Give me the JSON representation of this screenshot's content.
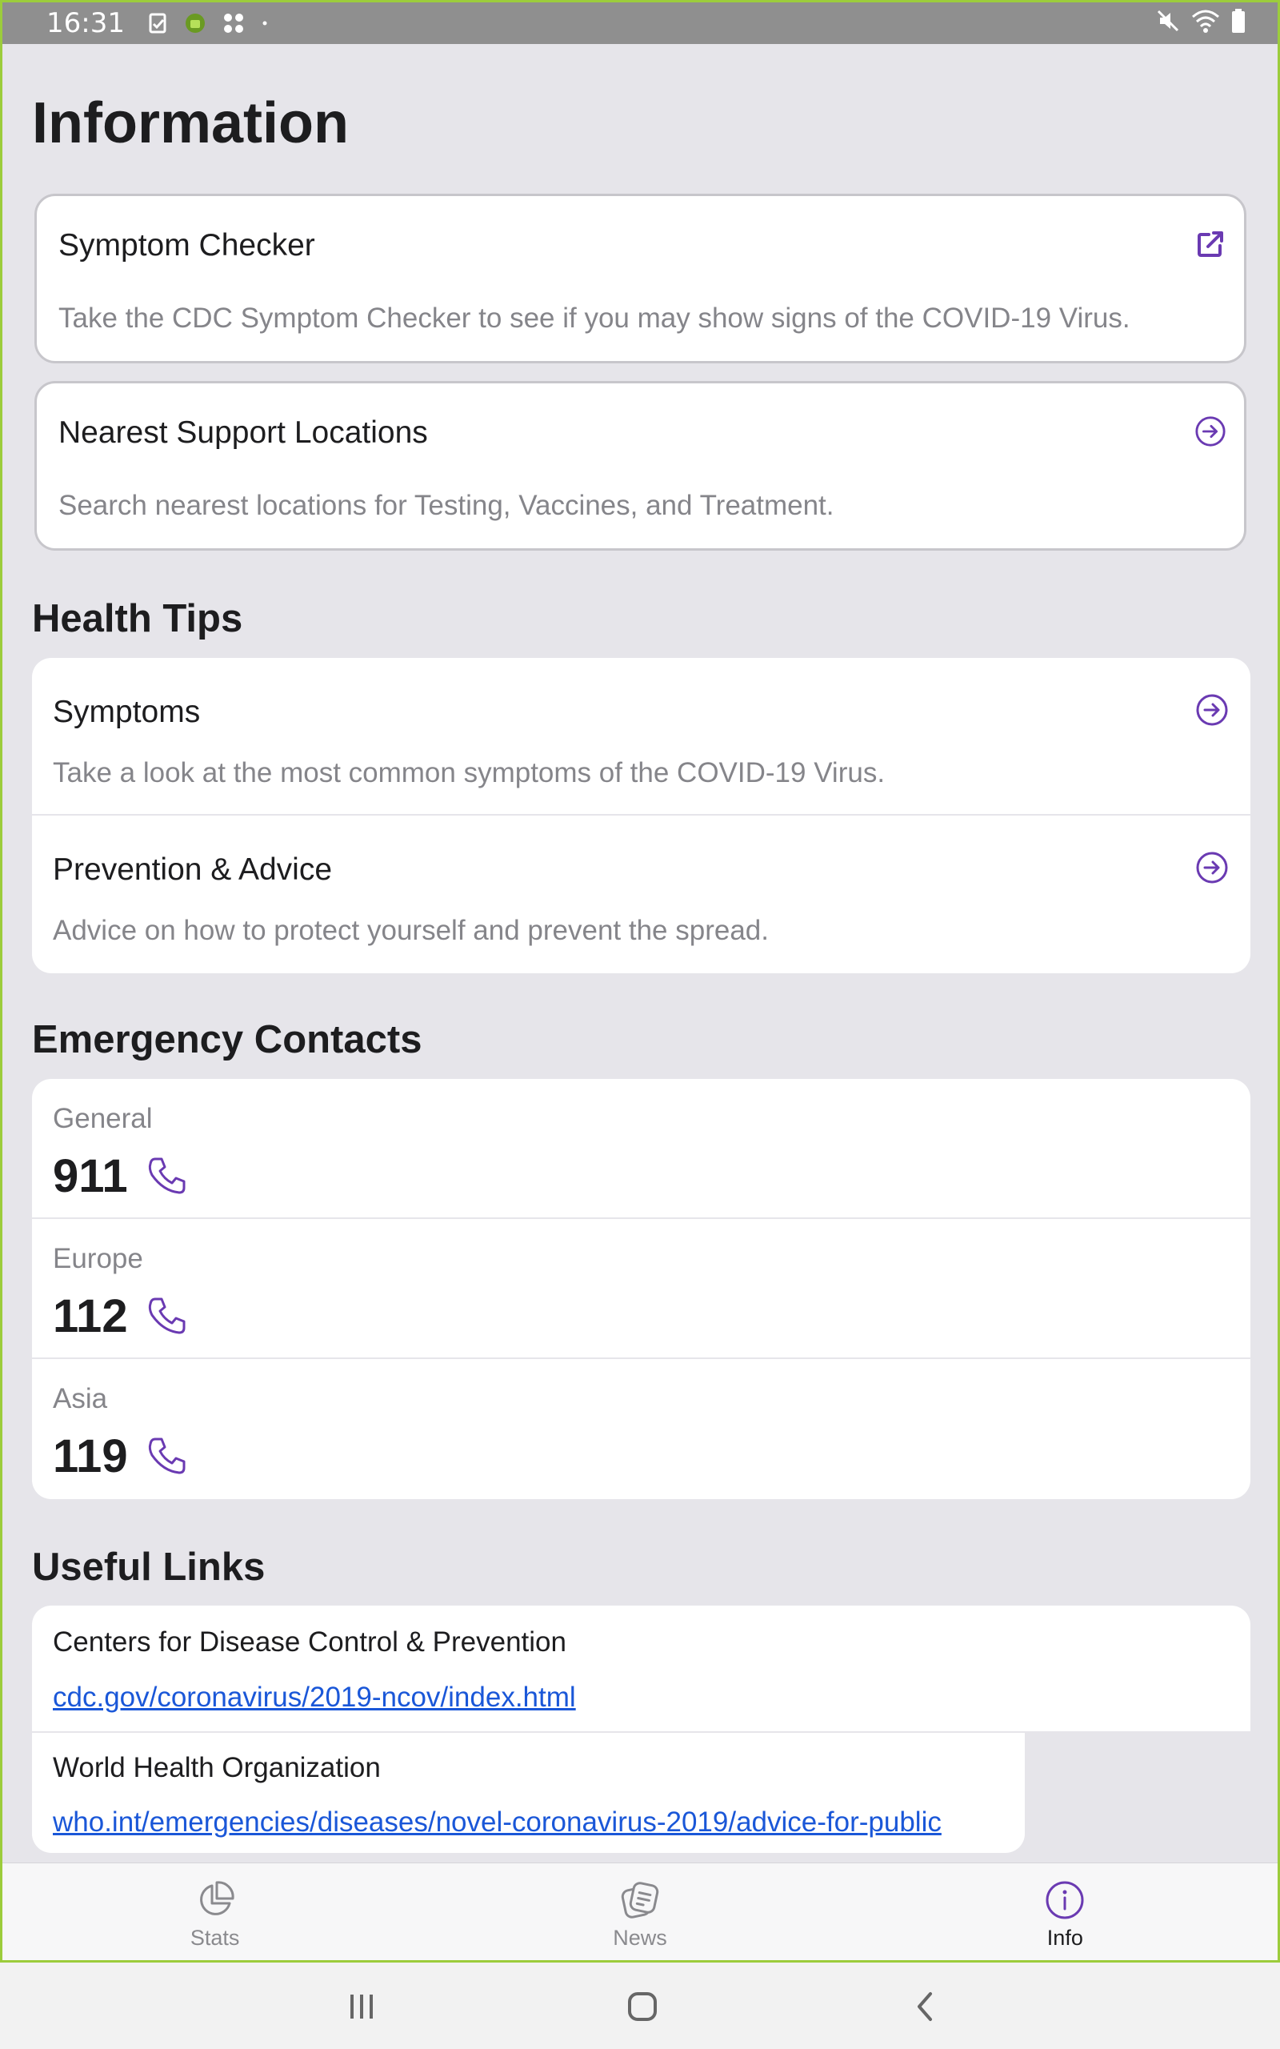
{
  "status_bar": {
    "time": "16:31"
  },
  "page": {
    "title": "Information"
  },
  "cards": [
    {
      "title": "Symptom Checker",
      "description": "Take the CDC Symptom Checker to see if you may show signs of the COVID-19 Virus.",
      "icon": "external-link-icon"
    },
    {
      "title": "Nearest Support Locations",
      "description": "Search nearest locations for Testing, Vaccines, and Treatment.",
      "icon": "arrow-circle-right-icon"
    }
  ],
  "health_tips": {
    "title": "Health Tips",
    "items": [
      {
        "title": "Symptoms",
        "description": "Take a look at the most common symptoms of the COVID-19 Virus."
      },
      {
        "title": "Prevention & Advice",
        "description": "Advice on how to protect yourself and prevent the spread."
      }
    ]
  },
  "emergency_contacts": {
    "title": "Emergency Contacts",
    "items": [
      {
        "region": "General",
        "number": "911"
      },
      {
        "region": "Europe",
        "number": "112"
      },
      {
        "region": "Asia",
        "number": "119"
      }
    ]
  },
  "useful_links": {
    "title": "Useful Links",
    "items": [
      {
        "title": "Centers for Disease Control & Prevention",
        "url": "cdc.gov/coronavirus/2019-ncov/index.html"
      },
      {
        "title": "World Health Organization",
        "url": "who.int/emergencies/diseases/novel-coronavirus-2019/advice-for-public"
      }
    ]
  },
  "tabs": [
    {
      "label": "Stats",
      "icon": "pie-chart-icon",
      "active": false
    },
    {
      "label": "News",
      "icon": "news-icon",
      "active": false
    },
    {
      "label": "Info",
      "icon": "info-icon",
      "active": true
    }
  ],
  "colors": {
    "accent": "#6a3ab2",
    "link": "#1a57d8",
    "background": "#e6e5ea",
    "status_bar": "#8f8f8f"
  }
}
